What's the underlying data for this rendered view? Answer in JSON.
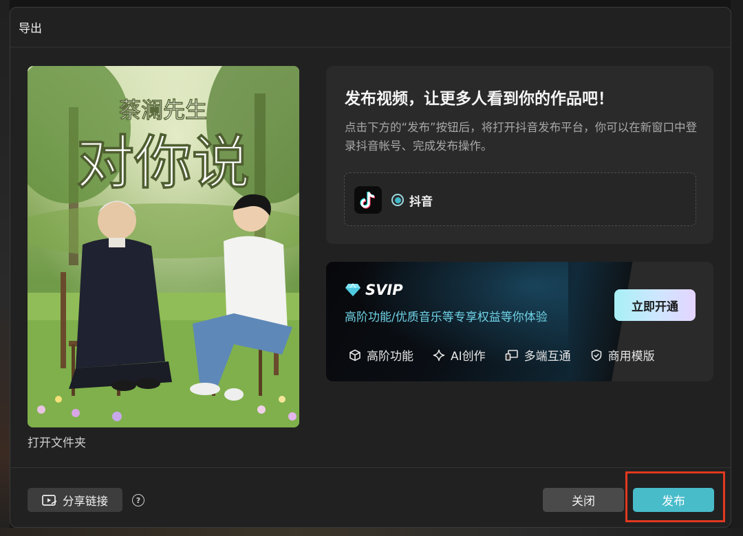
{
  "dialog": {
    "title": "导出"
  },
  "preview": {
    "title_small": "蔡澜先生",
    "title_large": "对你说",
    "open_folder": "打开文件夹"
  },
  "publish": {
    "heading": "发布视频，让更多人看到你的作品吧！",
    "description": "点击下方的“发布”按钮后，将打开抖音发布平台，你可以在新窗口中登录抖音帐号、完成发布操作。",
    "platform": {
      "label": "抖音",
      "selected": true,
      "icon": "douyin-logo"
    }
  },
  "svip": {
    "label": "SVIP",
    "subtitle": "高阶功能/优质音乐等专享权益等你体验",
    "cta": "立即开通",
    "features": [
      {
        "label": "高阶功能",
        "icon": "cube-icon"
      },
      {
        "label": "AI创作",
        "icon": "sparkle-icon"
      },
      {
        "label": "多端互通",
        "icon": "devices-icon"
      },
      {
        "label": "商用模版",
        "icon": "shield-check-icon"
      }
    ]
  },
  "footer": {
    "share_label": "分享链接",
    "help": "?",
    "close_label": "关闭",
    "publish_label": "发布"
  },
  "colors": {
    "accent": "#49bcca",
    "highlight": "#e2381f",
    "svip_text": "#6fd3e6"
  }
}
